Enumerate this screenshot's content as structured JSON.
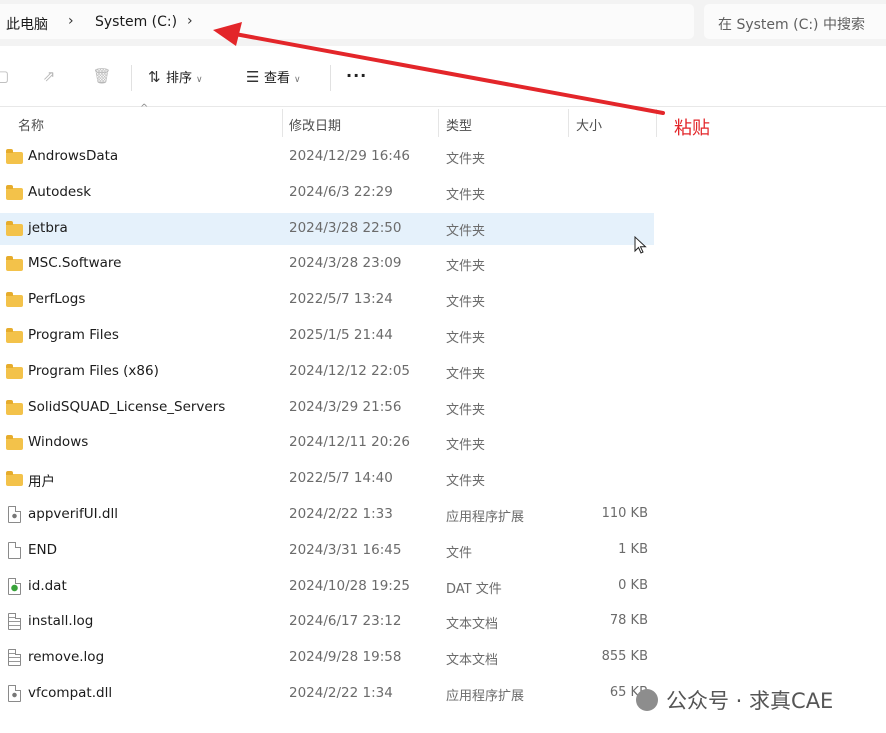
{
  "address": {
    "crumbs": [
      "此电脑",
      "System (C:)"
    ],
    "search_placeholder": "在 System (C:) 中搜索"
  },
  "toolbar": {
    "sort_label": "排序",
    "view_label": "查看",
    "more_label": "···"
  },
  "columns": {
    "name": "名称",
    "modified": "修改日期",
    "type": "类型",
    "size": "大小"
  },
  "files": [
    {
      "name": "AndrowsData",
      "date": "2024/12/29 16:46",
      "type": "文件夹",
      "size": "",
      "icon": "folder-icon"
    },
    {
      "name": "Autodesk",
      "date": "2024/6/3 22:29",
      "type": "文件夹",
      "size": "",
      "icon": "folder-icon"
    },
    {
      "name": "jetbra",
      "date": "2024/3/28 22:50",
      "type": "文件夹",
      "size": "",
      "icon": "folder-icon"
    },
    {
      "name": "MSC.Software",
      "date": "2024/3/28 23:09",
      "type": "文件夹",
      "size": "",
      "icon": "folder-icon"
    },
    {
      "name": "PerfLogs",
      "date": "2022/5/7 13:24",
      "type": "文件夹",
      "size": "",
      "icon": "folder-icon"
    },
    {
      "name": "Program Files",
      "date": "2025/1/5 21:44",
      "type": "文件夹",
      "size": "",
      "icon": "folder-icon"
    },
    {
      "name": "Program Files (x86)",
      "date": "2024/12/12 22:05",
      "type": "文件夹",
      "size": "",
      "icon": "folder-icon"
    },
    {
      "name": "SolidSQUAD_License_Servers",
      "date": "2024/3/29 21:56",
      "type": "文件夹",
      "size": "",
      "icon": "folder-icon"
    },
    {
      "name": "Windows",
      "date": "2024/12/11 20:26",
      "type": "文件夹",
      "size": "",
      "icon": "folder-icon"
    },
    {
      "name": "用户",
      "date": "2022/5/7 14:40",
      "type": "文件夹",
      "size": "",
      "icon": "folder-icon"
    },
    {
      "name": "appverifUI.dll",
      "date": "2024/2/22 1:33",
      "type": "应用程序扩展",
      "size": "110 KB",
      "icon": "dll-file-icon"
    },
    {
      "name": "END",
      "date": "2024/3/31 16:45",
      "type": "文件",
      "size": "1 KB",
      "icon": "file-icon"
    },
    {
      "name": "id.dat",
      "date": "2024/10/28 19:25",
      "type": "DAT 文件",
      "size": "0 KB",
      "icon": "dat-file-icon"
    },
    {
      "name": "install.log",
      "date": "2024/6/17 23:12",
      "type": "文本文档",
      "size": "78 KB",
      "icon": "text-file-icon"
    },
    {
      "name": "remove.log",
      "date": "2024/9/28 19:58",
      "type": "文本文档",
      "size": "855 KB",
      "icon": "text-file-icon"
    },
    {
      "name": "vfcompat.dll",
      "date": "2024/2/22 1:34",
      "type": "应用程序扩展",
      "size": "65 KB",
      "icon": "dll-file-icon"
    }
  ],
  "selected_row": "jetbra",
  "annotation": {
    "label": "粘贴",
    "color": "#e3262a"
  },
  "watermark": "公众号 · 求真CAE"
}
